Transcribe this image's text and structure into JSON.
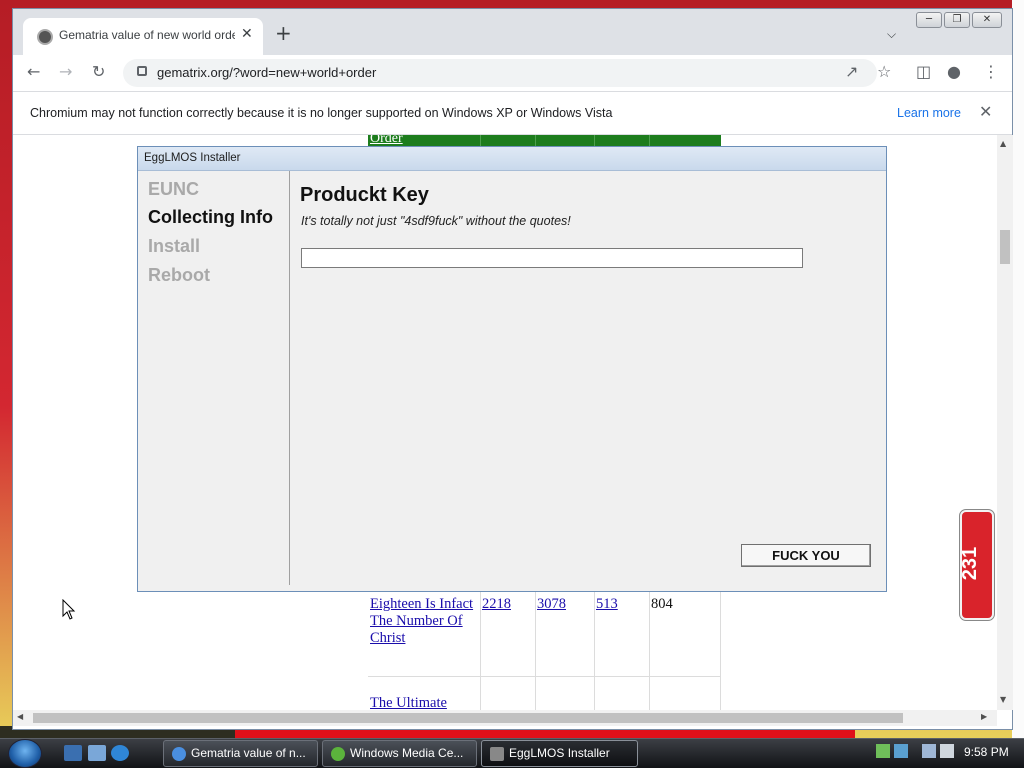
{
  "browser": {
    "tab_title": "Gematria value of new world order",
    "tab_close": "✕",
    "new_tab": "+",
    "address": "gematrix.org/?word=new+world+order",
    "infobar_text": "Chromium may not function correctly because it is no longer supported on Windows XP or Windows Vista",
    "infobar_link": "Learn more",
    "infobar_close": "✕"
  },
  "page": {
    "top_word": "Order",
    "row": {
      "word": "Eighteen Is Infact The Number Of Christ",
      "english": "2218",
      "hebrew": "3078",
      "simple": "513",
      "jewish": "804"
    },
    "next_word": "The Ultimate"
  },
  "dialog": {
    "title": "EggLMOS Installer",
    "steps": [
      {
        "label": "EUNC",
        "active": false
      },
      {
        "label": "Collecting Info",
        "active": true
      },
      {
        "label": "Install",
        "active": false
      },
      {
        "label": "Reboot",
        "active": false
      }
    ],
    "heading": "Produckt Key",
    "hint": "It's totally not just \"4sdf9fuck\" without the quotes!",
    "key_value": "",
    "action_label": "FUCK YOU"
  },
  "gadget": {
    "value": "231"
  },
  "taskbar": {
    "buttons": [
      {
        "label": "Gematria value of n...",
        "icon": "chromium-icon"
      },
      {
        "label": "Windows Media Ce...",
        "icon": "media-center-icon"
      },
      {
        "label": "EggLMOS Installer",
        "icon": "installer-icon",
        "active": true
      }
    ],
    "clock": "9:58 PM"
  }
}
